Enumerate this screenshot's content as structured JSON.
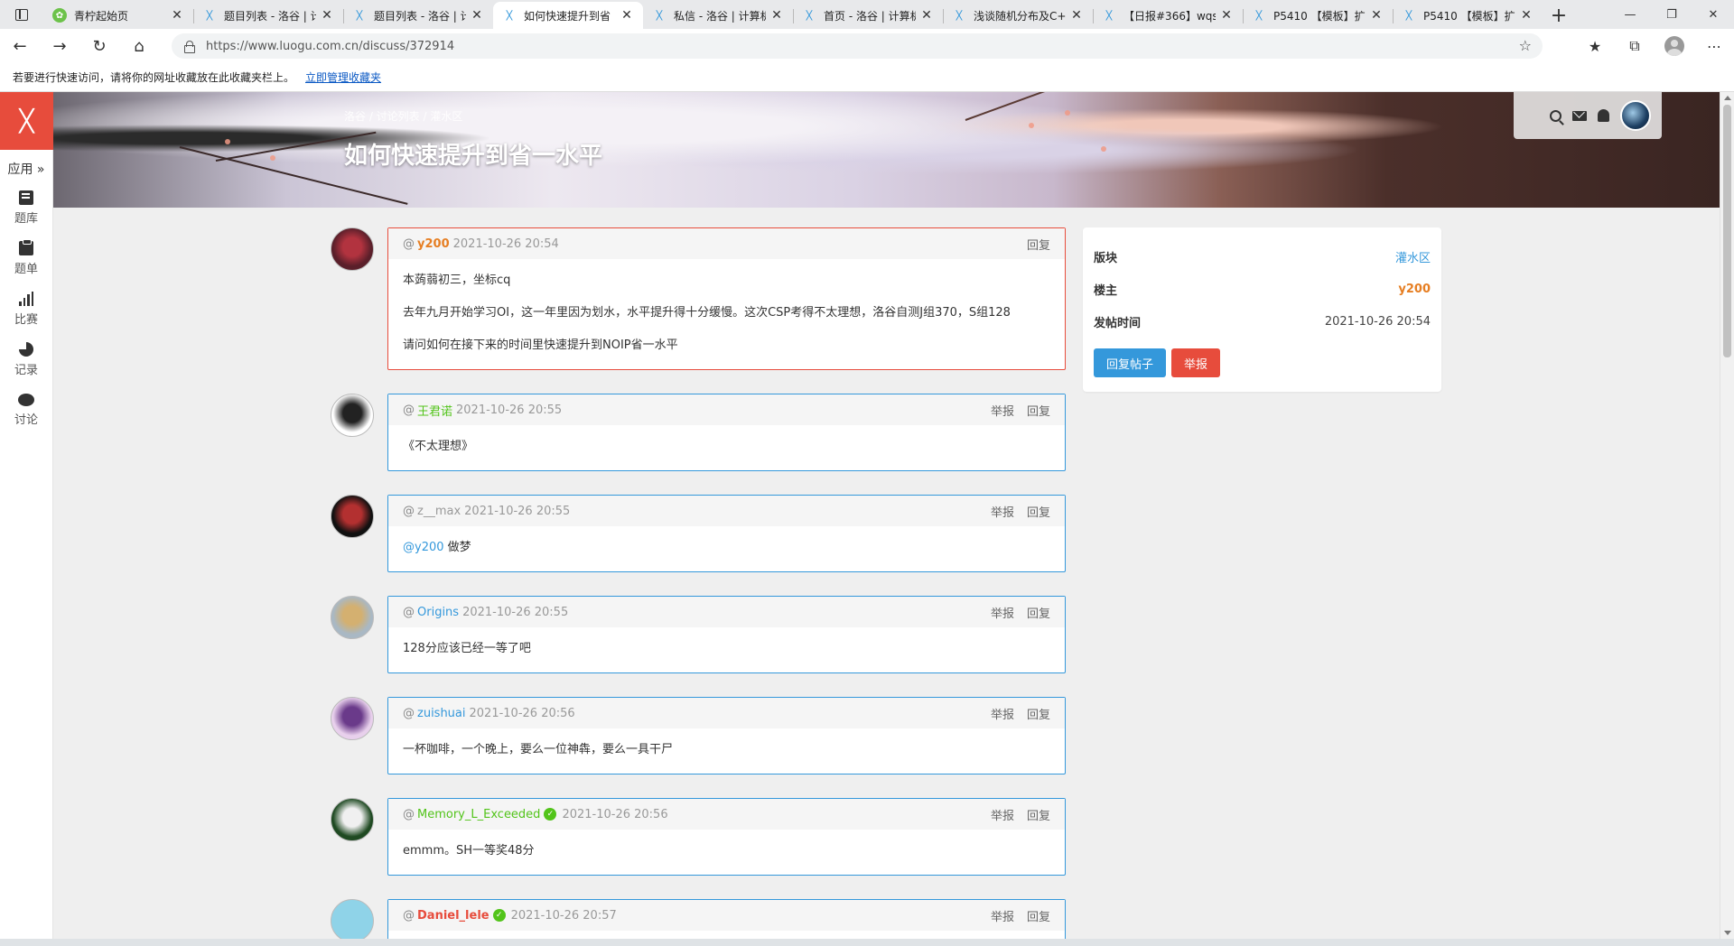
{
  "browser": {
    "tabs": [
      {
        "title": "青柠起始页",
        "icon": "green-leaf-icon"
      },
      {
        "title": "题目列表 - 洛谷 | 计",
        "icon": "luogu-icon"
      },
      {
        "title": "题目列表 - 洛谷 | 计",
        "icon": "luogu-icon"
      },
      {
        "title": "如何快速提升到省",
        "icon": "luogu-icon",
        "active": true
      },
      {
        "title": "私信 - 洛谷 | 计算机",
        "icon": "luogu-icon"
      },
      {
        "title": "首页 - 洛谷 | 计算机",
        "icon": "luogu-icon"
      },
      {
        "title": "浅谈随机分布及C+",
        "icon": "luogu-icon"
      },
      {
        "title": "【日报#366】wqs",
        "icon": "luogu-icon"
      },
      {
        "title": "P5410 【模板】扩",
        "icon": "luogu-icon"
      },
      {
        "title": "P5410 【模板】扩",
        "icon": "luogu-icon"
      }
    ],
    "url": "https://www.luogu.com.cn/discuss/372914",
    "favbar_text": "若要进行快速访问，请将你的网址收藏放在此收藏夹栏上。",
    "favbar_link": "立即管理收藏夹"
  },
  "sidebar": {
    "logo": "ᚷ",
    "app_label": "应用 »",
    "items": [
      {
        "label": "题库",
        "icon": "book-icon"
      },
      {
        "label": "题单",
        "icon": "clipboard-icon"
      },
      {
        "label": "比赛",
        "icon": "bar-chart-icon"
      },
      {
        "label": "记录",
        "icon": "pie-chart-icon"
      },
      {
        "label": "讨论",
        "icon": "chat-icon"
      }
    ]
  },
  "banner": {
    "breadcrumb": "洛谷 / 讨论列表 / 灌水区",
    "title": "如何快速提升到省一水平"
  },
  "posts": [
    {
      "user": "y200",
      "user_class": "orange",
      "time": "2021-10-26 20:54",
      "host": true,
      "actions": [
        "回复"
      ],
      "paragraphs": [
        "本蒟蒻初三，坐标cq",
        "去年九月开始学习OI，这一年里因为划水，水平提升得十分缓慢。这次CSP考得不太理想，洛谷自测J组370，S组128",
        "请问如何在接下来的时间里快速提升到NOIP省一水平"
      ],
      "avatar_colors": [
        "#5a1f2a",
        "#b2333f"
      ]
    },
    {
      "user": "王君诺",
      "user_class": "green",
      "time": "2021-10-26 20:55",
      "actions": [
        "举报",
        "回复"
      ],
      "paragraphs": [
        "《不太理想》"
      ],
      "avatar_colors": [
        "#ffffff",
        "#222222"
      ]
    },
    {
      "user": "z__max",
      "user_class": "gray",
      "time": "2021-10-26 20:55",
      "actions": [
        "举报",
        "回复"
      ],
      "mention": "@y200",
      "after_mention": " 做梦",
      "avatar_colors": [
        "#111111",
        "#b33030"
      ]
    },
    {
      "user": "Origins",
      "user_class": "blue",
      "time": "2021-10-26 20:55",
      "actions": [
        "举报",
        "回复"
      ],
      "paragraphs": [
        "128分应该已经一等了吧"
      ],
      "avatar_colors": [
        "#a9b8c4",
        "#d4b070"
      ]
    },
    {
      "user": "zuishuai",
      "user_class": "blue",
      "time": "2021-10-26 20:56",
      "actions": [
        "举报",
        "回复"
      ],
      "paragraphs": [
        "一杯咖啡，一个晚上，要么一位神犇，要么一具干尸"
      ],
      "avatar_colors": [
        "#e8d0ec",
        "#6a3a8a"
      ]
    },
    {
      "user": "Memory_L_Exceeded",
      "user_class": "green",
      "time": "2021-10-26 20:56",
      "verified": true,
      "actions": [
        "举报",
        "回复"
      ],
      "paragraphs": [
        "emmm。SH一等奖48分"
      ],
      "avatar_colors": [
        "#1f4a22",
        "#f0f0f0"
      ]
    },
    {
      "user": "Daniel_lele",
      "user_class": "red",
      "time": "2021-10-26 20:57",
      "verified": true,
      "actions": [
        "举报",
        "回复"
      ],
      "paragraphs": [
        ""
      ],
      "avatar_colors": [
        "#8fd3e8",
        "#8fd3e8"
      ]
    }
  ],
  "info": {
    "rows": [
      {
        "key": "版块",
        "value": "灌水区",
        "style": "link"
      },
      {
        "key": "楼主",
        "value": "y200",
        "style": "owner"
      },
      {
        "key": "发帖时间",
        "value": "2021-10-26 20:54",
        "style": "plain"
      }
    ],
    "reply_button": "回复帖子",
    "report_button": "举报"
  },
  "colors": {
    "brand": "#e74c3c",
    "accent": "#3498db",
    "host_border": "#e74c3c"
  }
}
